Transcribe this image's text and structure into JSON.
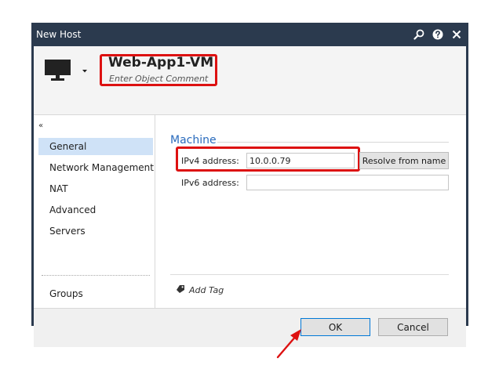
{
  "window": {
    "title": "New Host"
  },
  "header": {
    "object_name": "Web-App1-VM",
    "comment_placeholder": "Enter Object Comment"
  },
  "nav": {
    "collapse_glyph": "«",
    "items": [
      {
        "label": "General",
        "selected": true
      },
      {
        "label": "Network Management",
        "selected": false
      },
      {
        "label": "NAT",
        "selected": false
      },
      {
        "label": "Advanced",
        "selected": false
      },
      {
        "label": "Servers",
        "selected": false
      }
    ],
    "groups_label": "Groups"
  },
  "machine": {
    "section_title": "Machine",
    "ipv4_label": "IPv4 address:",
    "ipv4_value": "10.0.0.79",
    "ipv6_label": "IPv6 address:",
    "ipv6_value": "",
    "resolve_label": "Resolve from name"
  },
  "tags": {
    "add_tag_label": "Add Tag"
  },
  "footer": {
    "ok_label": "OK",
    "cancel_label": "Cancel"
  },
  "colors": {
    "titlebar": "#2b3a4e",
    "highlight": "#dd1111",
    "accent": "#2a6bbd",
    "selected_nav": "#cfe2f7"
  },
  "icons": {
    "title": [
      "search-icon",
      "help-icon",
      "close-icon"
    ],
    "object": "host-monitor-icon",
    "tag": "tag-icon",
    "annotation": "red-arrow-icon"
  }
}
